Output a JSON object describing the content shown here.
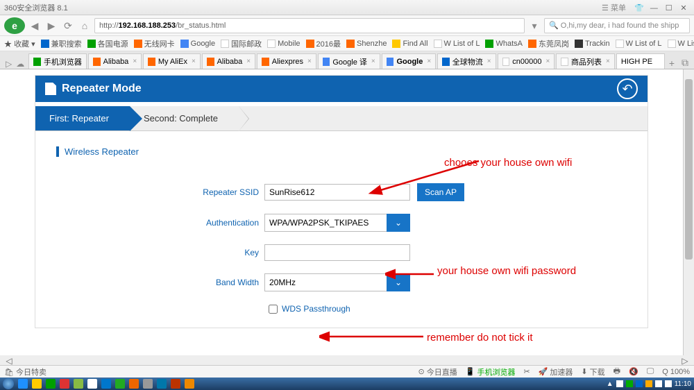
{
  "browser": {
    "title": "360安全浏览器 8.1",
    "menu_label": "菜单",
    "url_prefix": "http://",
    "url_ip": "192.168.188.253",
    "url_path": "/br_status.html",
    "search_placeholder": "O,hi,my dear, i had found the shipp"
  },
  "bookmarks_label": "收藏",
  "bookmarks": [
    {
      "label": "兼职搜索"
    },
    {
      "label": "各国电源"
    },
    {
      "label": "无线网卡"
    },
    {
      "label": "Google"
    },
    {
      "label": "国际邮政"
    },
    {
      "label": "Mobile"
    },
    {
      "label": "2016最"
    },
    {
      "label": "Shenzhe"
    },
    {
      "label": "Find All"
    },
    {
      "label": "List of L"
    },
    {
      "label": "WhatsA"
    },
    {
      "label": "东莞凤岗"
    },
    {
      "label": "Trackin"
    },
    {
      "label": "List of L"
    },
    {
      "label": "List of L"
    }
  ],
  "tabs": [
    {
      "label": "手机浏览器"
    },
    {
      "label": "Alibaba"
    },
    {
      "label": "My AliEx"
    },
    {
      "label": "Alibaba"
    },
    {
      "label": "Aliexpres"
    },
    {
      "label": "Google 译"
    },
    {
      "label": "Google"
    },
    {
      "label": "全球物流"
    },
    {
      "label": "cn00000"
    },
    {
      "label": "商品列表"
    },
    {
      "label": "HIGH PE"
    }
  ],
  "page": {
    "header": "Repeater Mode",
    "step1": "First: Repeater",
    "step2": "Second: Complete",
    "section": "Wireless Repeater",
    "labels": {
      "ssid": "Repeater SSID",
      "auth": "Authentication",
      "key": "Key",
      "bw": "Band Width",
      "wds": "WDS Passthrough"
    },
    "values": {
      "ssid": "SunRise612",
      "auth": "WPA/WPA2PSK_TKIPAES",
      "key": "",
      "bw": "20MHz"
    },
    "scan_btn": "Scan AP"
  },
  "annotations": {
    "a1": "chooes your house own wifi",
    "a2": "your house own wifi password",
    "a3": "remember do not tick it"
  },
  "status": {
    "left": "今日特卖",
    "live": "今日直播",
    "mobile": "手机浏览器",
    "speed": "加速器",
    "dl": "下载",
    "mute_icon": "🔇",
    "zoom": "100%"
  },
  "clock": "11:10"
}
